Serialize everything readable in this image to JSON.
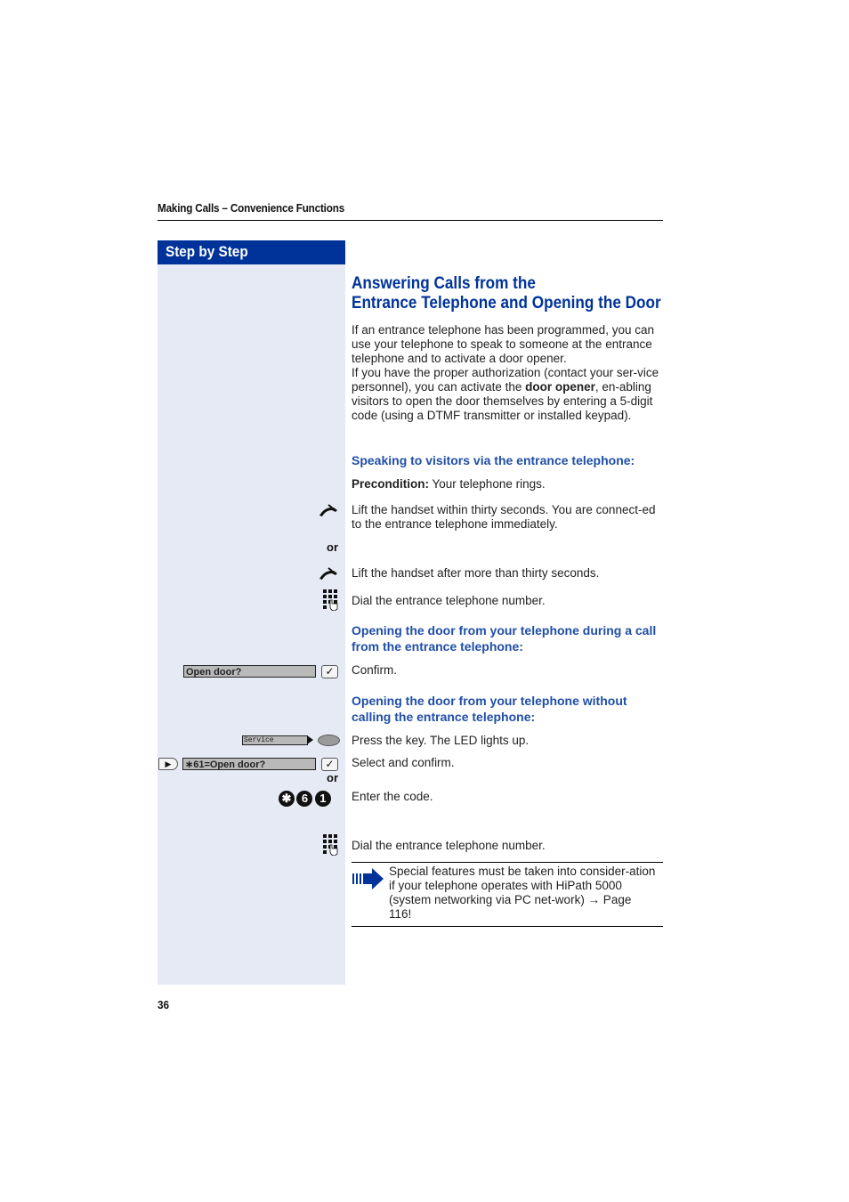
{
  "page": {
    "running_head": "Making Calls – Convenience Functions",
    "page_number": "36"
  },
  "sidebar": {
    "title": "Step by Step"
  },
  "content": {
    "title_line1": "Answering Calls from the",
    "title_line2": "Entrance Telephone and Opening the Door",
    "intro_part1": "If an entrance telephone has been programmed, you can use your telephone to speak to someone at the entrance telephone and to activate a door opener.",
    "intro_part2_pre": "If you have the proper authorization (contact your ser-vice personnel), you can activate the ",
    "intro_part2_bold": "door opener",
    "intro_part2_post": ", en-abling visitors to open the door themselves by entering a 5-digit code (using a DTMF transmitter or installed keypad).",
    "section1_heading": "Speaking to visitors via the entrance telephone:",
    "precondition_label": "Precondition:",
    "precondition_text": " Your telephone rings.",
    "step_lift_within": "Lift the handset within thirty seconds. You are connect-ed to the entrance telephone immediately.",
    "or_label": "or",
    "step_lift_after": "Lift the handset after more than thirty seconds.",
    "step_dial_1": "Dial the entrance telephone number.",
    "section2_heading": "Opening the door from your telephone during a call from the entrance telephone:",
    "display_open_door": "Open door?",
    "step_confirm": "Confirm.",
    "section3_heading": "Opening the door from your telephone without calling the entrance telephone:",
    "service_key_label": "Service",
    "step_press_key": "Press the key. The LED lights up.",
    "display_star61": "∗61=Open door?",
    "step_select_confirm": "Select and confirm.",
    "or_label_2": "or",
    "code_keys": [
      "✱",
      "6",
      "1"
    ],
    "step_enter_code": "Enter the code.",
    "step_dial_2": "Dial the entrance telephone number.",
    "note_text": "Special features must be taken into consider-ation if your telephone operates with HiPath 5000 (system networking via PC net-work) → Page 116!"
  },
  "icons": {
    "handset": "lift-handset-icon",
    "keypad": "dial-keypad-icon",
    "check": "✓",
    "arrow_right": "▶",
    "note": "note-arrow-icon"
  },
  "colors": {
    "brand_blue": "#003399",
    "heading_blue": "#1f4ea8",
    "sidebar_bg": "#e6eaf4"
  }
}
